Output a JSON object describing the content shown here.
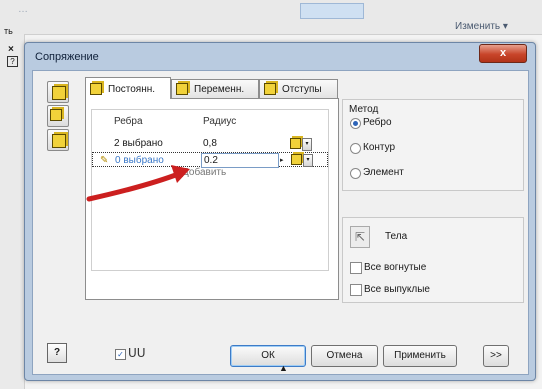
{
  "background": {
    "top_text": "…",
    "left_text": "ть",
    "left_close": "×",
    "left_help": "?",
    "edit_menu": "Изменить ▾"
  },
  "dialog": {
    "title": "Сопряжение",
    "close_glyph": "x"
  },
  "tabs": [
    {
      "label": "Постоянн.",
      "active": true
    },
    {
      "label": "Переменн.",
      "active": false
    },
    {
      "label": "Отступы",
      "active": false
    }
  ],
  "table": {
    "headers": {
      "edges": "Ребра",
      "radius": "Радиус"
    },
    "rows": [
      {
        "edges": "2 выбрано",
        "radius": "0,8"
      },
      {
        "edges": "0 выбрано",
        "radius": "0.2",
        "editing": true
      }
    ],
    "add_label": "Добавить",
    "dropdown_glyph": "▾",
    "edit_arrow": "▸",
    "pencil_glyph": "✎"
  },
  "method": {
    "title": "Метод",
    "options": [
      {
        "label": "Ребро",
        "selected": true
      },
      {
        "label": "Контур",
        "selected": false
      },
      {
        "label": "Элемент",
        "selected": false
      }
    ]
  },
  "bodies": {
    "label": "Тела",
    "cursor_glyph": "⇱",
    "checks": [
      {
        "label": "Все вогнутые",
        "checked": false
      },
      {
        "label": "Все выпуклые",
        "checked": false
      }
    ]
  },
  "footer": {
    "help": "?",
    "preview_checked": true,
    "check_glyph": "✓",
    "preview_glyph": "ᑌᑌ",
    "buttons": {
      "ok": "ОК",
      "cancel": "Отмена",
      "apply": "Применить",
      "more": ">>"
    },
    "expand_glyph": "▲"
  },
  "icons": [
    "cube-icon",
    "pencil-icon",
    "dropdown-icon",
    "cursor-icon",
    "glasses-icon",
    "help-icon"
  ],
  "colors": {
    "title_bar": "#b9cbe0",
    "close_red": "#c8452a",
    "selected_text": "#3a78c8",
    "annotation_arrow": "#cc1f1f",
    "cube_yellow": "#f1d23a"
  }
}
